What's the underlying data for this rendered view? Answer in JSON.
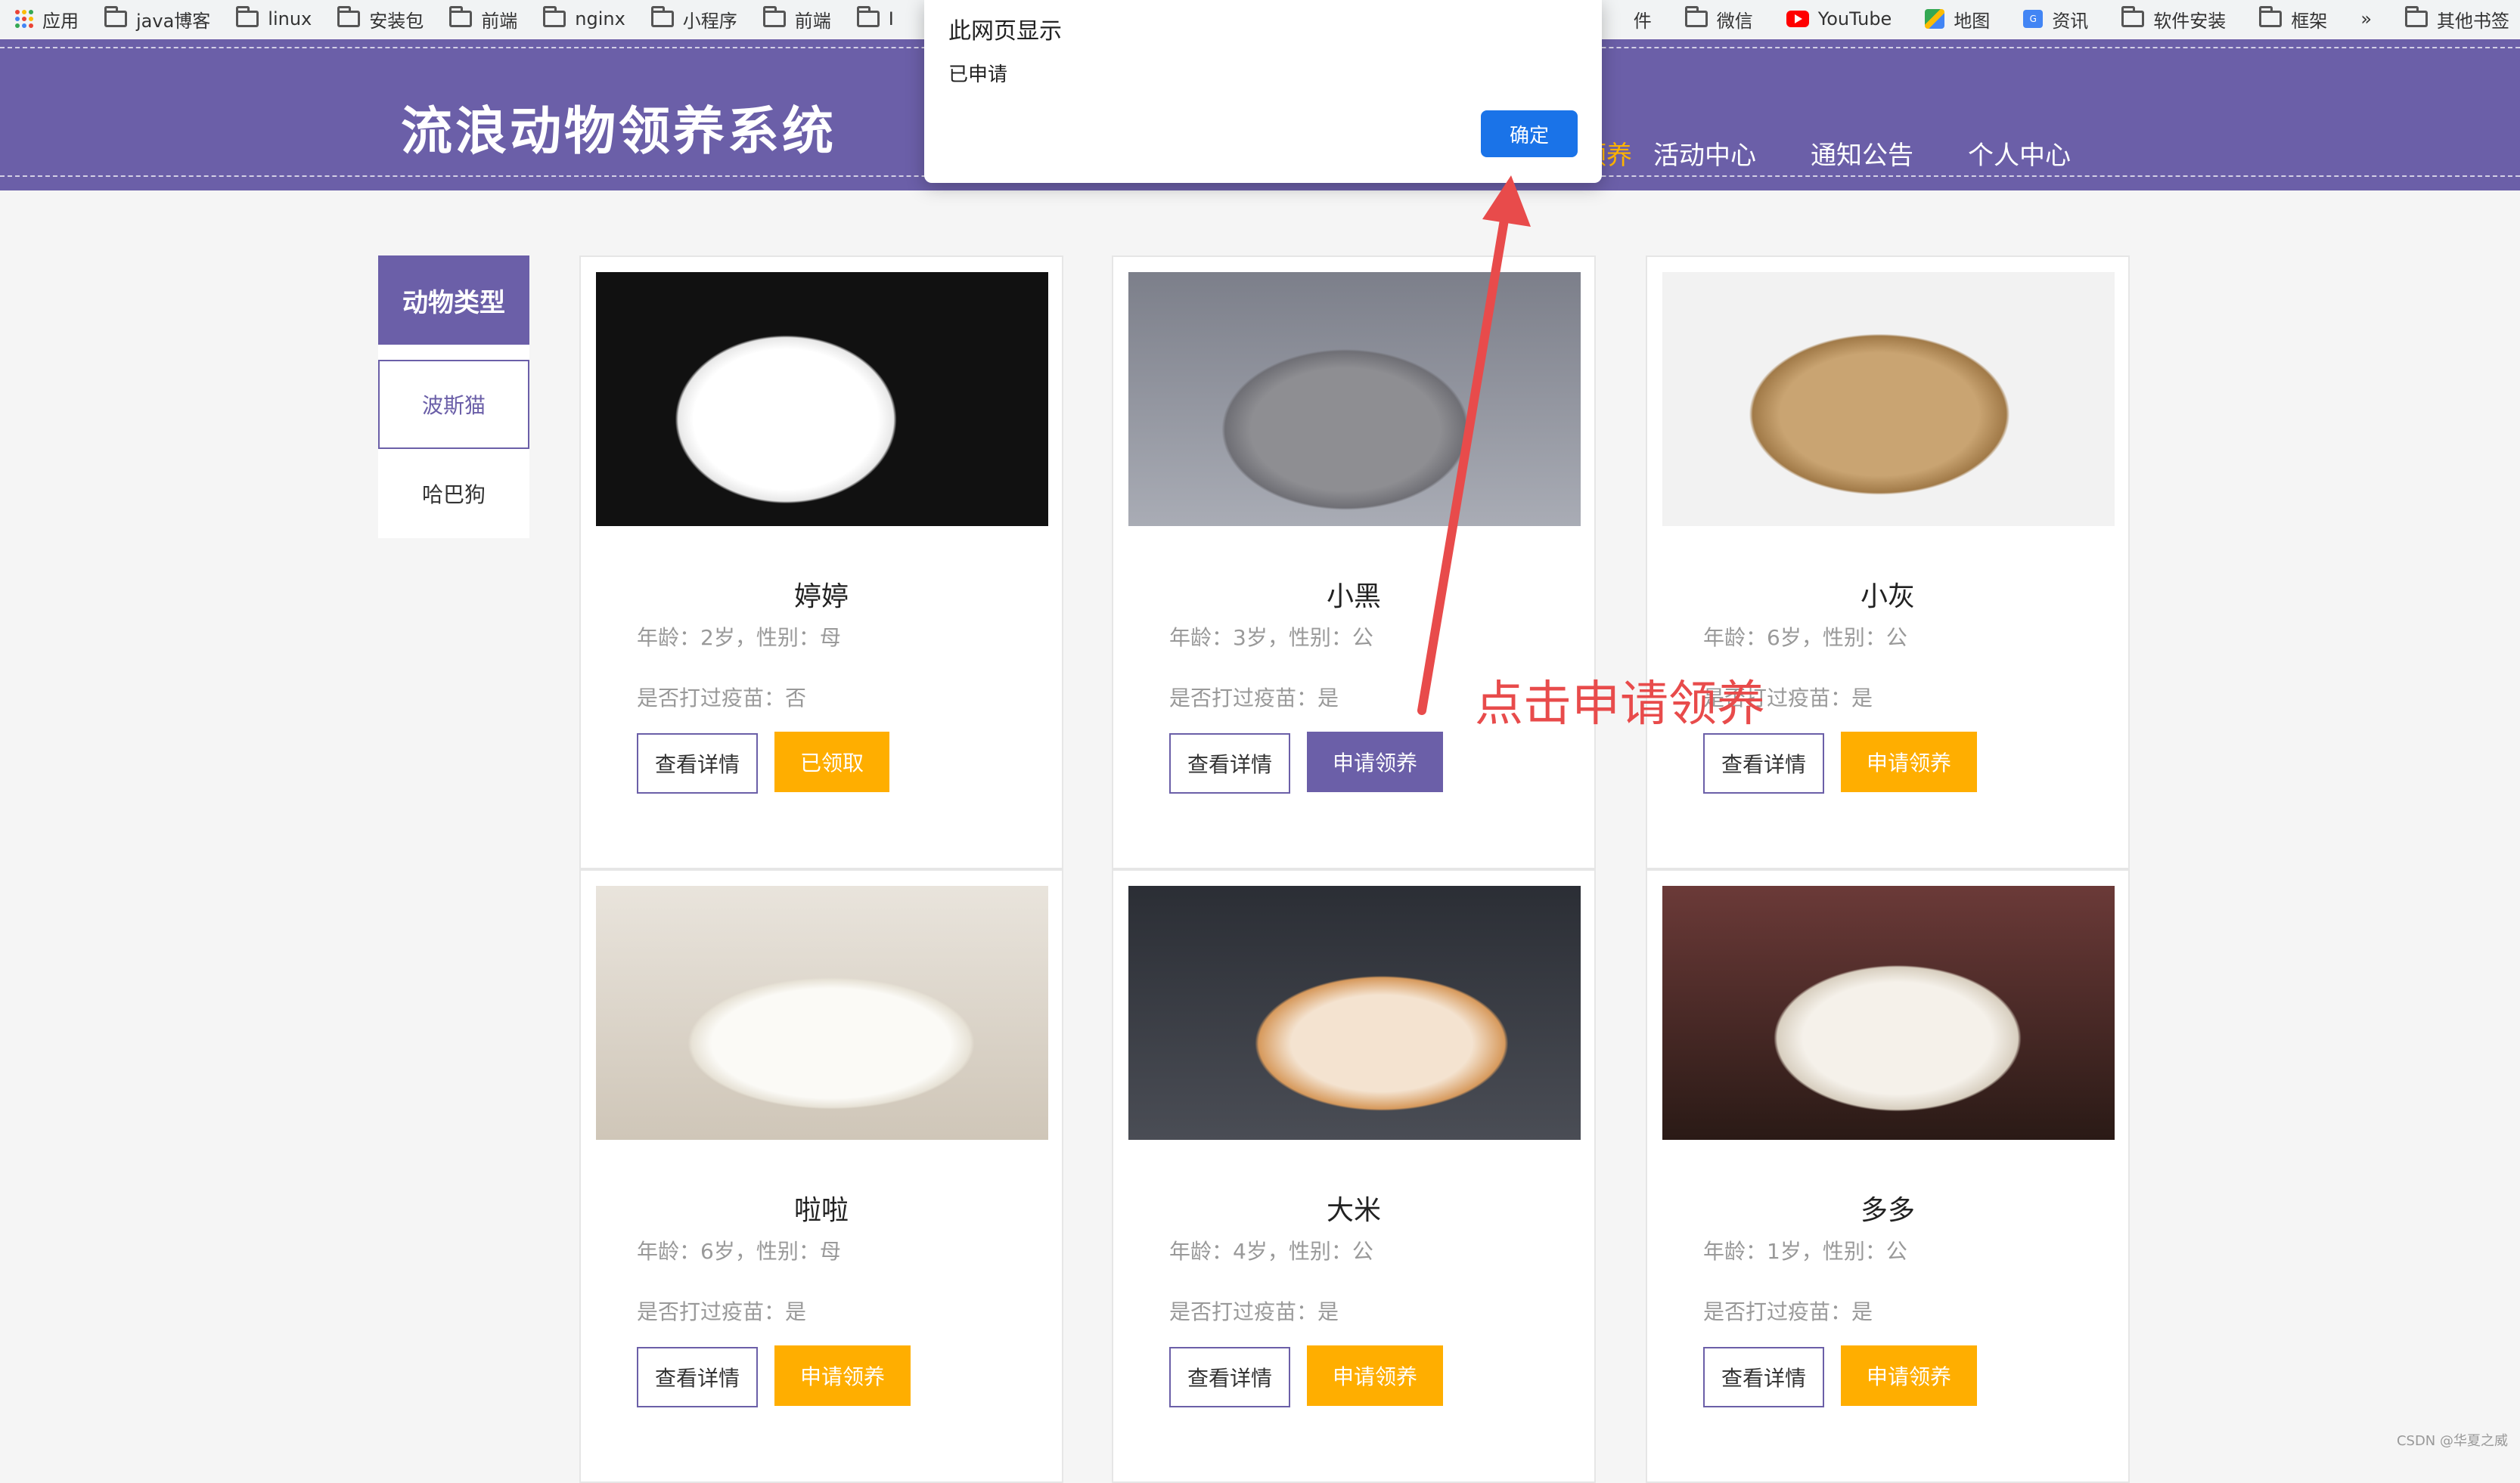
{
  "bookmarks": {
    "apps": "应用",
    "folders": [
      "java博客",
      "linux",
      "安装包",
      "前端",
      "nginx",
      "小程序",
      "前端"
    ],
    "partial_left": "I",
    "right_items": [
      "件",
      "微信",
      "YouTube",
      "地图",
      "资讯",
      "软件安装",
      "框架"
    ],
    "more": "»",
    "other": "其他书签"
  },
  "header": {
    "title": "流浪动物领养系统",
    "partial_nav": "领养",
    "nav": [
      "活动中心",
      "通知公告",
      "个人中心"
    ]
  },
  "sidebar": {
    "heading": "动物类型",
    "items": [
      {
        "label": "波斯猫",
        "active": true
      },
      {
        "label": "哈巴狗",
        "active": false
      }
    ]
  },
  "cards": [
    {
      "name": "婷婷",
      "meta1": "年龄：2岁，性别：母",
      "meta2": "是否打过疫苗：否",
      "detail": "查看详情",
      "adopt": "已领取",
      "adopt_color": "#ffae00"
    },
    {
      "name": "小黑",
      "meta1": "年龄：3岁，性别：公",
      "meta2": "是否打过疫苗：是",
      "detail": "查看详情",
      "adopt": "申请领养",
      "adopt_color": "#6b5fa8"
    },
    {
      "name": "小灰",
      "meta1": "年龄：6岁，性别：公",
      "meta2": "是否打过疫苗：是",
      "detail": "查看详情",
      "adopt": "申请领养",
      "adopt_color": "#ffae00"
    },
    {
      "name": "啦啦",
      "meta1": "年龄：6岁，性别：母",
      "meta2": "是否打过疫苗：是",
      "detail": "查看详情",
      "adopt": "申请领养",
      "adopt_color": "#ffae00"
    },
    {
      "name": "大米",
      "meta1": "年龄：4岁，性别：公",
      "meta2": "是否打过疫苗：是",
      "detail": "查看详情",
      "adopt": "申请领养",
      "adopt_color": "#ffae00"
    },
    {
      "name": "多多",
      "meta1": "年龄：1岁，性别：公",
      "meta2": "是否打过疫苗：是",
      "detail": "查看详情",
      "adopt": "申请领养",
      "adopt_color": "#ffae00"
    }
  ],
  "dialog": {
    "title": "此网页显示",
    "message": "已申请",
    "ok": "确定"
  },
  "annotation": "点击申请领养",
  "watermark": "CSDN @华夏之威",
  "colors": {
    "brand_purple": "#6b5fa8",
    "accent_orange": "#ffae00",
    "dialog_blue": "#1a73e8",
    "annotation_red": "#e84b4b"
  }
}
